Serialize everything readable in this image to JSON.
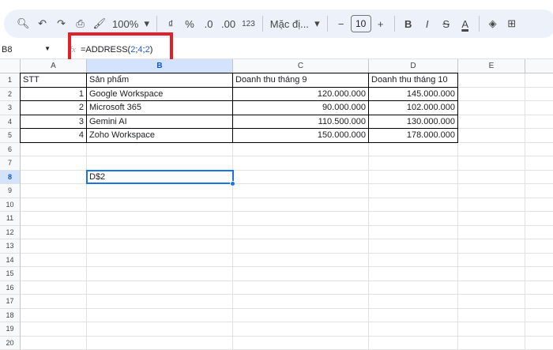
{
  "toolbar": {
    "zoom": "100%",
    "currency": "₫",
    "percent": "%",
    "dec_decrease": ".0",
    "dec_increase": ".00",
    "format_123": "123",
    "font": "Mặc đị...",
    "font_size": "10",
    "bold": "B",
    "italic": "I",
    "strike": "S",
    "text_color": "A",
    "text_color_value": "#000000"
  },
  "formula_bar": {
    "name_box": "B8",
    "fx": "fx",
    "formula_prefix": "=ADDRESS(",
    "arg1": "2",
    "arg2": "4",
    "arg3": "2",
    "sep": ";",
    "formula_suffix": ")"
  },
  "columns": [
    "A",
    "B",
    "C",
    "D",
    "E"
  ],
  "selected_cell": "B8",
  "rows": [
    [
      "STT",
      "Sản phẩm",
      "Doanh thu tháng 9",
      "Doanh thu tháng 10"
    ],
    [
      "1",
      "Google Workspace",
      "120.000.000",
      "145.000.000"
    ],
    [
      "2",
      "Microsoft 365",
      "90.000.000",
      "102.000.000"
    ],
    [
      "3",
      "Gemini AI",
      "110.500.000",
      "130.000.000"
    ],
    [
      "4",
      "Zoho Workspace",
      "150.000.000",
      "178.000.000"
    ]
  ],
  "b8_value": "D$2",
  "row_numbers": [
    "1",
    "2",
    "3",
    "4",
    "5",
    "6",
    "7",
    "8",
    "9",
    "10",
    "11",
    "12",
    "13",
    "14",
    "15",
    "16",
    "17",
    "18",
    "19",
    "20"
  ]
}
